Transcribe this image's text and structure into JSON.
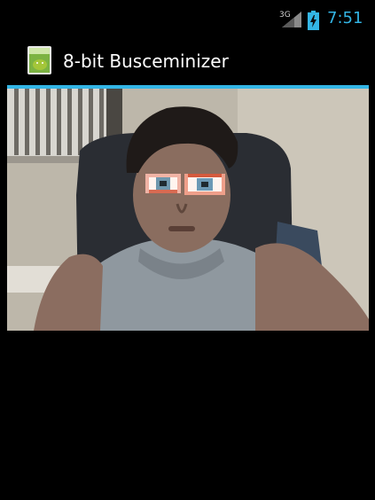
{
  "status_bar": {
    "network_type": "3G",
    "time": "7:51",
    "signal_icon": "signal-bars-icon",
    "battery_icon": "battery-charging-icon"
  },
  "action_bar": {
    "app_icon": "android-app-icon",
    "title": "8-bit Busceminizer"
  },
  "camera_view": {
    "content": "live camera preview with pixelated eye overlays"
  },
  "colors": {
    "accent": "#33b5e5",
    "background": "#000000"
  }
}
